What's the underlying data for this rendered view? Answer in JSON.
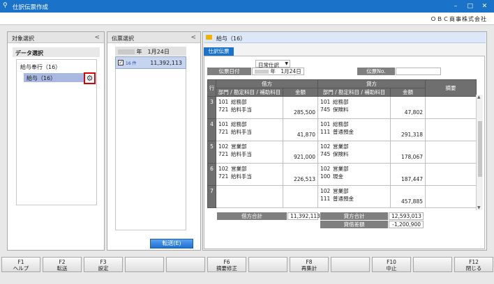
{
  "window": {
    "title": "仕訳伝票作成",
    "company": "ＯＢＣ商事株式会社"
  },
  "target_panel": {
    "title": "対象選択",
    "section": "データ選択",
    "tree_parent": "給与奉行（16）",
    "tree_child": "給与（16）"
  },
  "voucher_panel": {
    "title": "伝票選択",
    "date_header": "年　1月24日",
    "row_badge": "16 件",
    "row_amount": "11,392,113",
    "transfer_button": "転送(E)"
  },
  "detail_panel": {
    "title": "給与（16）",
    "tab": "仕訳伝票",
    "voucher_type": "日常仕訳",
    "date_label": "伝票日付",
    "date_value": "年　1月24日",
    "no_label": "伝票No.",
    "no_value": "",
    "headers": {
      "row": "行",
      "debit": "借方",
      "credit": "貸方",
      "dept_account": "部門 / 勘定科目 / 補助科目",
      "amount": "金額",
      "memo": "摘要"
    },
    "rows": [
      {
        "n": "3",
        "d_dept_code": "101",
        "d_dept": "総務部",
        "d_acct_code": "721",
        "d_acct": "給料手当",
        "d_amount": "285,500",
        "c_dept_code": "101",
        "c_dept": "総務部",
        "c_acct_code": "745",
        "c_acct": "保険料",
        "c_amount": "47,802"
      },
      {
        "n": "4",
        "d_dept_code": "101",
        "d_dept": "総務部",
        "d_acct_code": "721",
        "d_acct": "給料手当",
        "d_amount": "41,870",
        "c_dept_code": "101",
        "c_dept": "総務部",
        "c_acct_code": "111",
        "c_acct": "普通預金",
        "c_amount": "291,318"
      },
      {
        "n": "5",
        "d_dept_code": "102",
        "d_dept": "営業部",
        "d_acct_code": "721",
        "d_acct": "給料手当",
        "d_amount": "921,000",
        "c_dept_code": "102",
        "c_dept": "営業部",
        "c_acct_code": "745",
        "c_acct": "保険料",
        "c_amount": "178,067"
      },
      {
        "n": "6",
        "d_dept_code": "102",
        "d_dept": "営業部",
        "d_acct_code": "721",
        "d_acct": "給料手当",
        "d_amount": "226,513",
        "c_dept_code": "102",
        "c_dept": "営業部",
        "c_acct_code": "100",
        "c_acct": "現金",
        "c_amount": "187,447"
      },
      {
        "n": "7",
        "d_dept_code": "",
        "d_dept": "",
        "d_acct_code": "",
        "d_acct": "",
        "d_amount": "",
        "c_dept_code": "102",
        "c_dept": "営業部",
        "c_acct_code": "111",
        "c_acct": "普通預金",
        "c_amount": "457,885"
      }
    ],
    "totals": {
      "debit_label": "借方合計",
      "debit_value": "11,392,113",
      "credit_label": "貸方合計",
      "credit_value": "12,593,013",
      "diff_label": "貸借差額",
      "diff_value": "-1,200,900"
    }
  },
  "function_keys": [
    {
      "key": "F1",
      "label": "ヘルプ"
    },
    {
      "key": "F2",
      "label": "転送"
    },
    {
      "key": "F3",
      "label": "設定"
    },
    {
      "key": "",
      "label": ""
    },
    {
      "key": "",
      "label": ""
    },
    {
      "key": "F6",
      "label": "摘要修正"
    },
    {
      "key": "",
      "label": ""
    },
    {
      "key": "F8",
      "label": "再集計"
    },
    {
      "key": "",
      "label": ""
    },
    {
      "key": "F10",
      "label": "中止"
    },
    {
      "key": "",
      "label": ""
    },
    {
      "key": "F12",
      "label": "閉じる"
    }
  ],
  "colors": {
    "titlebar": "#1a73c8",
    "selection": "#c7d4ef",
    "highlight_border": "#e00000",
    "header_gray": "#6f6f6f"
  }
}
